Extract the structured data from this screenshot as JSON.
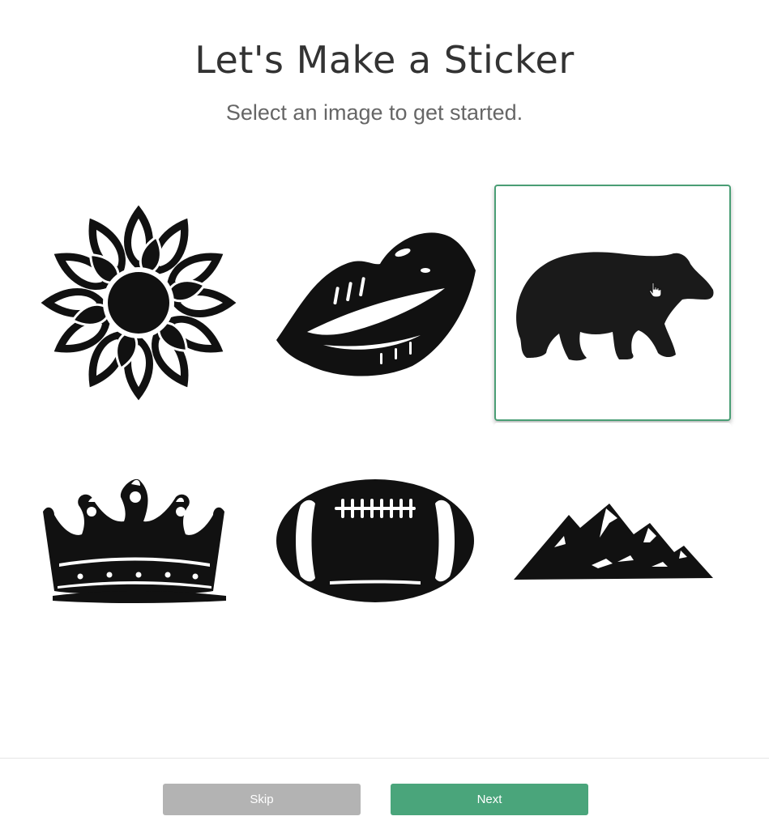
{
  "header": {
    "title": "Let's Make a Sticker",
    "subtitle": "Select an image to get started."
  },
  "images": [
    {
      "icon": "sunflower-icon",
      "selected": false
    },
    {
      "icon": "lips-icon",
      "selected": false
    },
    {
      "icon": "bear-icon",
      "selected": true
    },
    {
      "icon": "crown-icon",
      "selected": false
    },
    {
      "icon": "football-icon",
      "selected": false
    },
    {
      "icon": "mountains-icon",
      "selected": false
    }
  ],
  "footer": {
    "skip_label": "Skip",
    "next_label": "Next"
  },
  "colors": {
    "accent": "#4aa57b",
    "selected_border": "#4a9e75",
    "skip_button": "#b3b3b3"
  }
}
